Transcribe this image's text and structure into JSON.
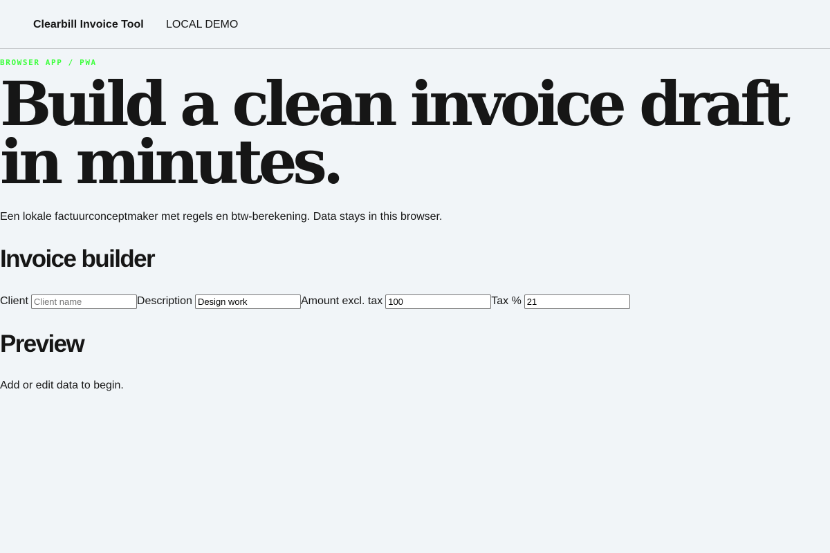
{
  "header": {
    "brand": "Clearbill Invoice Tool",
    "mode": "LOCAL DEMO"
  },
  "hero": {
    "eyebrow": "BROWSER APP / PWA",
    "title": "Build a clean invoice draft in minutes.",
    "intro": "Een lokale factuurconceptmaker met regels en btw-berekening. Data stays in this browser."
  },
  "builder": {
    "title": "Invoice builder",
    "fields": {
      "client": {
        "label": "Client",
        "value": "",
        "placeholder": "Client name"
      },
      "description": {
        "label": "Description",
        "value": "Design work"
      },
      "amount": {
        "label": "Amount excl. tax",
        "value": "100"
      },
      "tax": {
        "label": "Tax %",
        "value": "21"
      }
    }
  },
  "preview": {
    "title": "Preview",
    "empty_message": "Add or edit data to begin."
  },
  "colors": {
    "background": "#f1f5f8",
    "text": "#161616",
    "eyebrow": "#3cff3c",
    "divider": "#b4b7ba"
  }
}
